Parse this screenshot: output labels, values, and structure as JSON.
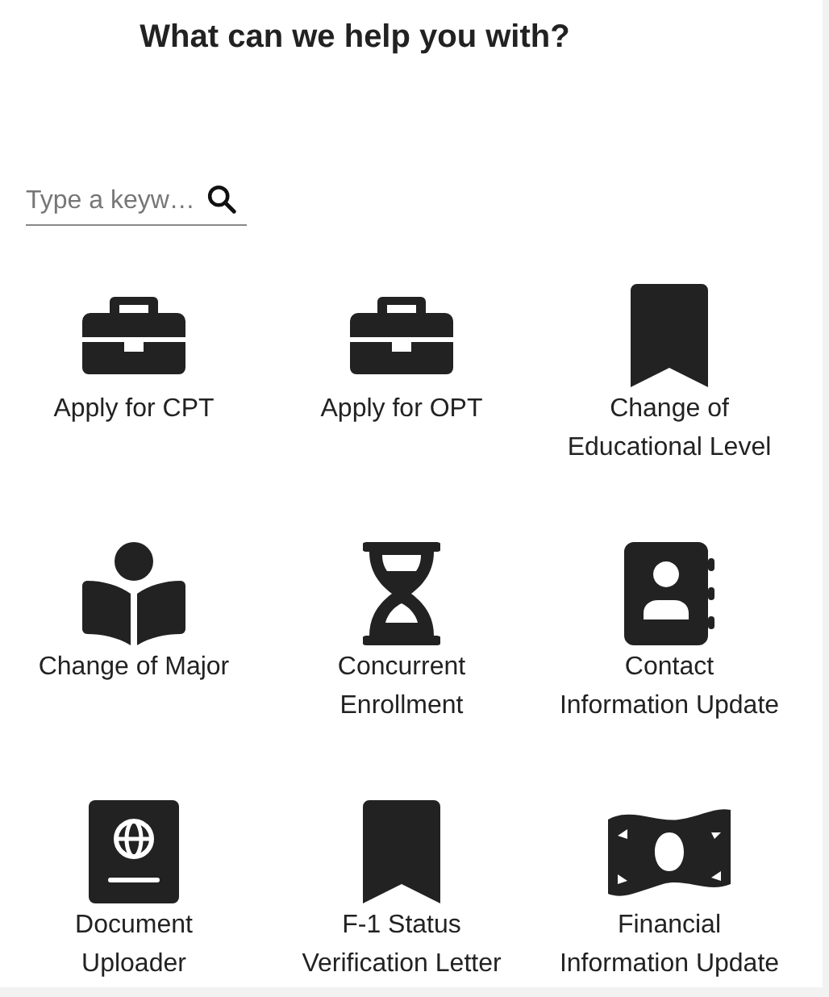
{
  "title": "What can we help you with?",
  "search": {
    "placeholder": "Type a keyw…"
  },
  "services": [
    {
      "label": "Apply for CPT",
      "kind": "briefcase"
    },
    {
      "label": "Apply for OPT",
      "kind": "briefcase"
    },
    {
      "label": "Change of\nEducational Level",
      "kind": "bookmark"
    },
    {
      "label": "Change of Major",
      "kind": "reader"
    },
    {
      "label": "Concurrent\nEnrollment",
      "kind": "hourglass"
    },
    {
      "label": "Contact\nInformation Update",
      "kind": "contact"
    },
    {
      "label": "Document\nUploader",
      "kind": "passport"
    },
    {
      "label": "F-1 Status\nVerification Letter",
      "kind": "bookmark"
    },
    {
      "label": "Financial\nInformation Update",
      "kind": "money"
    }
  ]
}
